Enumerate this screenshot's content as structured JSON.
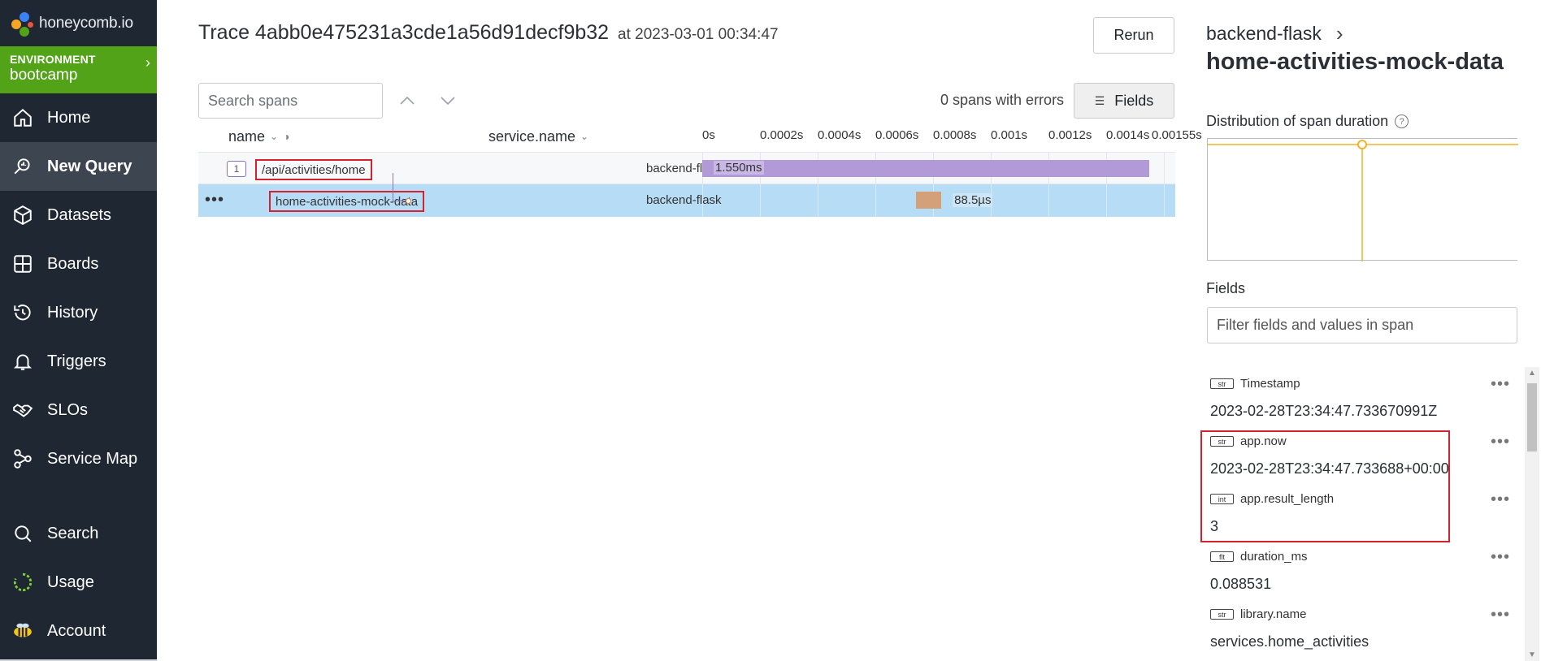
{
  "sidebar": {
    "logo_text": "honeycomb.io",
    "environment_label": "ENVIRONMENT",
    "environment_name": "bootcamp",
    "items": [
      {
        "label": "Home",
        "icon": "home-icon"
      },
      {
        "label": "New Query",
        "icon": "query-icon",
        "active": true
      },
      {
        "label": "Datasets",
        "icon": "datasets-icon"
      },
      {
        "label": "Boards",
        "icon": "boards-icon"
      },
      {
        "label": "History",
        "icon": "history-icon"
      },
      {
        "label": "Triggers",
        "icon": "bell-icon"
      },
      {
        "label": "SLOs",
        "icon": "handshake-icon"
      },
      {
        "label": "Service Map",
        "icon": "service-map-icon"
      },
      {
        "label": "Search",
        "icon": "search-icon"
      },
      {
        "label": "Usage",
        "icon": "usage-icon"
      },
      {
        "label": "Account",
        "icon": "bee-icon"
      }
    ],
    "brand_color": "#52a318"
  },
  "trace": {
    "title": "Trace 4abb0e475231a3cde1a56d91decf9b32",
    "at": "at 2023-03-01 00:34:47",
    "rerun_label": "Rerun",
    "search_placeholder": "Search spans",
    "errors_text": "0 spans with errors",
    "fields_label": "Fields",
    "columns": {
      "name": "name",
      "service": "service.name"
    },
    "ticks": [
      "0s",
      "0.0002s",
      "0.0004s",
      "0.0006s",
      "0.0008s",
      "0.001s",
      "0.0012s",
      "0.0014s",
      "0.00155s"
    ],
    "rows": [
      {
        "name": "/api/activities/home",
        "service": "backend-flask",
        "child_count": "1",
        "duration": "1.550ms",
        "start_s": 0,
        "duration_s": 0.00155
      },
      {
        "name": "home-activities-mock-data",
        "service": "backend-flask",
        "duration": "88.5µs",
        "start_s": 0.00074,
        "duration_s": 8.85e-05
      }
    ],
    "root_bar_color": "#b19ad6",
    "child_bar_color": "#d4a07a"
  },
  "panel": {
    "service": "backend-flask",
    "span_name": "home-activities-mock-data",
    "distribution_label": "Distribution of span duration",
    "fields_heading": "Fields",
    "filter_placeholder": "Filter fields and values in span",
    "fields": [
      {
        "type": "str",
        "key": "Timestamp",
        "value": "2023-02-28T23:34:47.733670991Z"
      },
      {
        "type": "str",
        "key": "app.now",
        "value": "2023-02-28T23:34:47.733688+00:00"
      },
      {
        "type": "int",
        "key": "app.result_length",
        "value": "3"
      },
      {
        "type": "flt",
        "key": "duration_ms",
        "value": "0.088531"
      },
      {
        "type": "str",
        "key": "library.name",
        "value": "services.home_activities"
      }
    ],
    "highlight_color": "#d2222d"
  }
}
